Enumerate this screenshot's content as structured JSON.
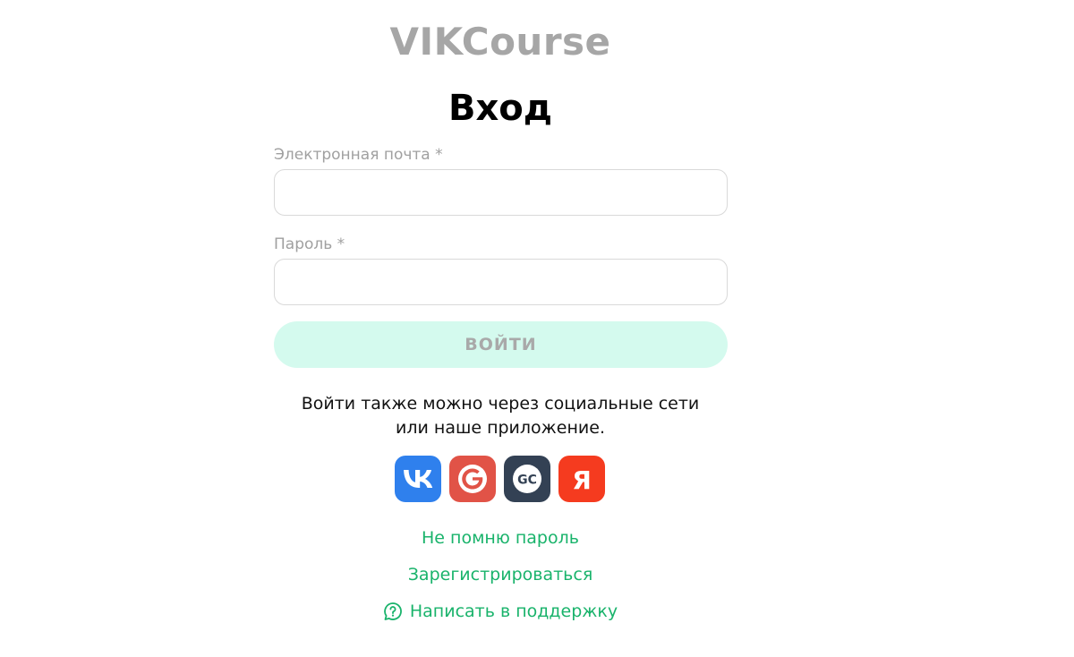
{
  "logo": {
    "text": "VIKCourse",
    "color": "#a6a6a6"
  },
  "title": "Вход",
  "form": {
    "email": {
      "label": "Электронная почта *",
      "value": ""
    },
    "password": {
      "label": "Пароль *",
      "value": ""
    },
    "submit_label": "ВОЙТИ"
  },
  "social": {
    "text_line1": "Войти также можно через социальные сети",
    "text_line2": "или наше приложение.",
    "buttons": [
      {
        "icon": "vk-icon",
        "color": "#2f80ed"
      },
      {
        "icon": "google-icon",
        "color": "#e15347"
      },
      {
        "icon": "getcourse-icon",
        "color": "#334154"
      },
      {
        "icon": "yandex-icon",
        "color": "#f53b1f"
      }
    ]
  },
  "links": {
    "forgot_password": "Не помню пароль",
    "register": "Зарегистрироваться",
    "support": "Написать в поддержку"
  },
  "colors": {
    "accent": "#19b36b",
    "button_bg": "#d4faee",
    "button_text": "#a9a9a9"
  }
}
